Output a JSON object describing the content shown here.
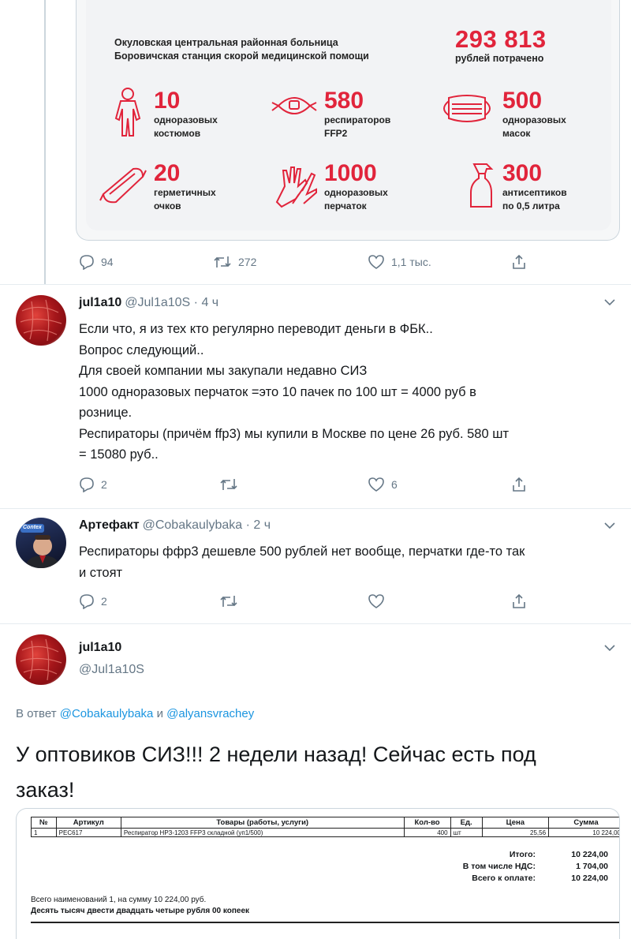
{
  "infographic": {
    "org_line1": "Окуловская центральная районная больница",
    "org_line2": "Боровичская станция скорой медицинской помощи",
    "total_amount": "293 813",
    "total_label": "рублей потрачено",
    "accent_color": "#e1243b",
    "stats": [
      {
        "icon": "suit-icon",
        "number": "10",
        "label1": "одноразовых",
        "label2": "костюмов"
      },
      {
        "icon": "respirator-icon",
        "number": "580",
        "label1": "респираторов",
        "label2": "FFP2"
      },
      {
        "icon": "mask-icon",
        "number": "500",
        "label1": "одноразовых",
        "label2": "масок"
      },
      {
        "icon": "goggles-icon",
        "number": "20",
        "label1": "герметичных",
        "label2": "очков"
      },
      {
        "icon": "gloves-icon",
        "number": "1000",
        "label1": "одноразовых",
        "label2": "перчаток"
      },
      {
        "icon": "spray-bottle-icon",
        "number": "300",
        "label1": "антисептиков",
        "label2": "по 0,5 литра"
      }
    ]
  },
  "tweet0_actions": {
    "replies": "94",
    "retweets": "272",
    "likes": "1,1 тыс."
  },
  "tweet1": {
    "name": "jul1a10",
    "handle": "@Jul1a10S · 4 ч",
    "lines": [
      "Если что, я из тех  кто регулярно переводит деньги в ФБК..",
      "Вопрос следующий..",
      "Для своей компании мы закупали недавно СИЗ",
      "1000 одноразовых перчаток =это 10 пачек по 100 шт = 4000 руб в",
      "рознице.",
      "Респираторы (причём ffp3) мы купили в Москве по цене 26 руб. 580 шт",
      "= 15080 руб.."
    ],
    "actions": {
      "replies": "2",
      "retweets": "",
      "likes": "6"
    }
  },
  "tweet2": {
    "name": "Артефакт",
    "handle": "@Cobakaulybaka · 2 ч",
    "lines": [
      "Респираторы ффр3 дешевле 500 рублей нет вообще, перчатки где-то так",
      "и стоят"
    ],
    "avatar_badge": "Contex",
    "actions": {
      "replies": "2",
      "retweets": "",
      "likes": ""
    }
  },
  "tweet3": {
    "name": "jul1a10",
    "handle": "@Jul1a10S",
    "reply_prefix": "В ответ",
    "reply_user1": "@Cobakaulybaka",
    "reply_and": "и",
    "reply_user2": "@alyansvrachey",
    "text_line1": "У оптовиков СИЗ!!! 2 недели назад! Сейчас есть под",
    "text_line2": "заказ!"
  },
  "invoice": {
    "headers": [
      "№",
      "Артикул",
      "Товары (работы, услуги)",
      "Кол-во",
      "Ед.",
      "Цена",
      "Сумма"
    ],
    "row": [
      "1",
      "PEC617",
      "Респиратор НРЗ-1203 FFP3 складной (уп1/500)",
      "400",
      "шт",
      "25,56",
      "10 224,00"
    ],
    "totals": [
      {
        "label": "Итого:",
        "value": "10 224,00"
      },
      {
        "label": "В том числе НДС:",
        "value": "1 704,00"
      },
      {
        "label": "Всего к оплате:",
        "value": "10 224,00"
      }
    ],
    "summary": "Всего наименований 1, на сумму 10 224,00 руб.",
    "words": "Десять тысяч двести двадцать четыре рубля 00 копеек"
  }
}
